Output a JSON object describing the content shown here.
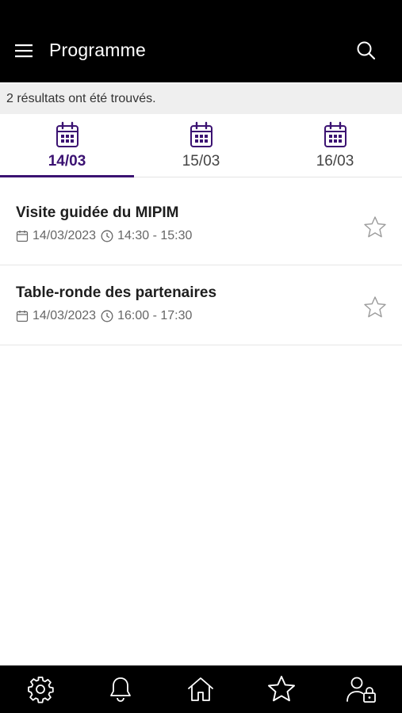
{
  "header": {
    "title": "Programme",
    "menu_icon": "hamburger-icon",
    "search_icon": "search-icon"
  },
  "results": {
    "text": "2 résultats ont été trouvés."
  },
  "accent_color": "#3b1272",
  "date_tabs": [
    {
      "label": "14/03",
      "active": true
    },
    {
      "label": "15/03",
      "active": false
    },
    {
      "label": "16/03",
      "active": false
    }
  ],
  "events": [
    {
      "title": "Visite guidée du MIPIM",
      "date": "14/03/2023",
      "time": "14:30 - 15:30",
      "favorite": false
    },
    {
      "title": "Table-ronde des partenaires",
      "date": "14/03/2023",
      "time": "16:00 - 17:30",
      "favorite": false
    }
  ],
  "bottom_nav": [
    {
      "icon": "gear-icon"
    },
    {
      "icon": "bell-icon"
    },
    {
      "icon": "home-icon"
    },
    {
      "icon": "star-icon"
    },
    {
      "icon": "user-lock-icon"
    }
  ]
}
